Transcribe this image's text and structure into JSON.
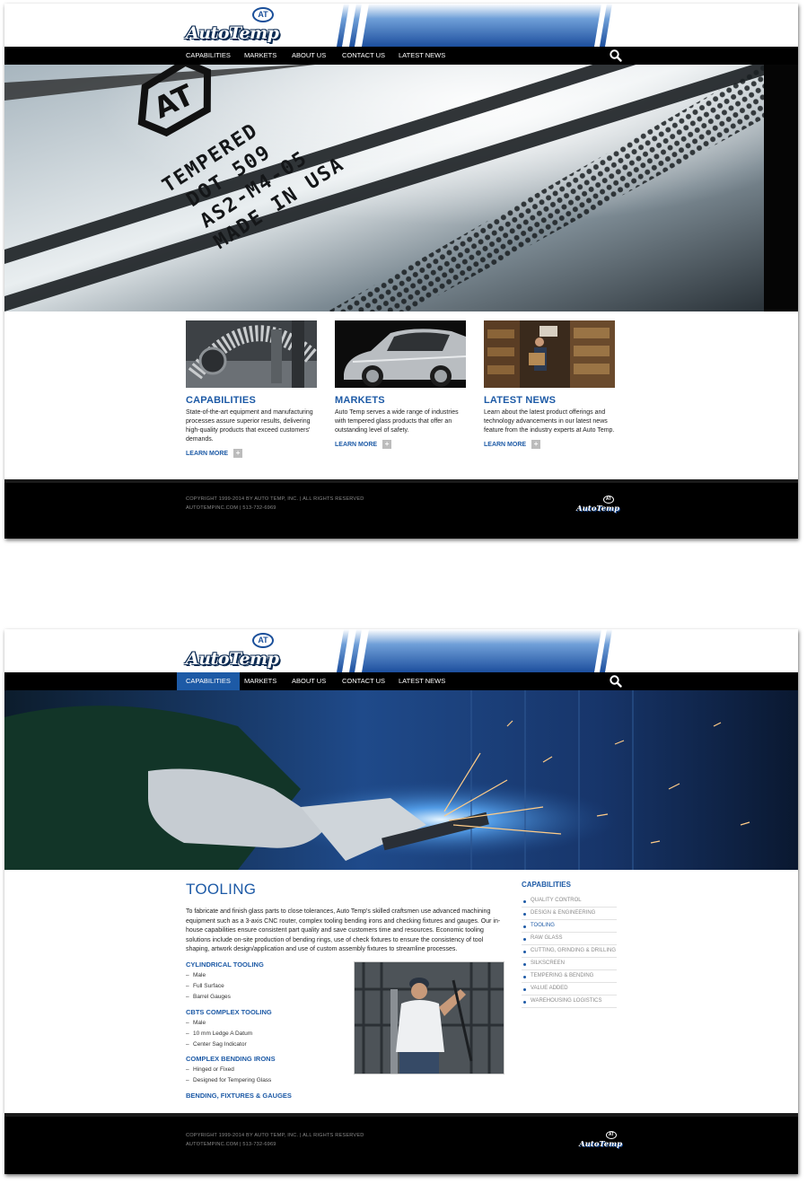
{
  "brand": {
    "name": "AutoTemp",
    "badge": "AT"
  },
  "nav": {
    "items": [
      "CAPABILITIES",
      "MARKETS",
      "ABOUT US",
      "CONTACT US",
      "LATEST NEWS"
    ]
  },
  "colors": {
    "brand_blue": "#1d5aa6",
    "nav_bg": "#000000",
    "footer_bg": "#000000"
  },
  "icons": {
    "search": "search-icon",
    "learn_more": "plus-icon"
  },
  "home": {
    "hero": {
      "etched_lines": [
        "TEMPERED",
        "DOT 509",
        "AS2-M4-05",
        "MADE IN USA"
      ],
      "logo_mark": "AT"
    },
    "cards": [
      {
        "title": "CAPABILITIES",
        "text": "State-of-the-art equipment and manufacturing processes assure superior results, delivering high-quality products that exceed customers' demands.",
        "link": "LEARN MORE"
      },
      {
        "title": "MARKETS",
        "text": "Auto Temp serves a wide range of industries with tempered glass products that offer an outstanding level of safety.",
        "link": "LEARN MORE"
      },
      {
        "title": "LATEST NEWS",
        "text": "Learn about the latest product offerings and technology advancements in our latest news feature from the industry experts at Auto Temp.",
        "link": "LEARN MORE"
      }
    ]
  },
  "footer": {
    "copyright": "COPYRIGHT 1999-2014 BY AUTO TEMP, INC.  |  ALL RIGHTS RESERVED",
    "contact": "AUTOTEMPINC.COM  |  513-732-6969"
  },
  "tooling": {
    "active_nav": "CAPABILITIES",
    "title": "TOOLING",
    "intro": "To fabricate and finish glass parts to close tolerances, Auto Temp's skilled craftsmen use advanced machining equipment such as a 3-axis CNC router, complex tooling bending irons and checking fixtures and gauges. Our in-house capabilities ensure consistent part quality and save customers time and resources. Economic tooling solutions include on-site production of bending rings, use of check fixtures to ensure the consistency of tool shaping, artwork design/application and use of custom assembly fixtures to streamline processes.",
    "sections": [
      {
        "heading": "CYLINDRICAL TOOLING",
        "items": [
          "Male",
          "Full Surface",
          "Barrel Gauges"
        ]
      },
      {
        "heading": "CBTS COMPLEX TOOLING",
        "items": [
          "Male",
          "10 mm Ledge A Datum",
          "Center Sag Indicator"
        ]
      },
      {
        "heading": "COMPLEX BENDING IRONS",
        "items": [
          "Hinged or Fixed",
          "Designed for Tempering Glass"
        ]
      },
      {
        "heading": "BENDING, FIXTURES & GAUGES",
        "items": []
      }
    ],
    "sidebar": {
      "title": "CAPABILITIES",
      "items": [
        "QUALITY CONTROL",
        "DESIGN & ENGINEERING",
        "TOOLING",
        "RAW GLASS",
        "CUTTING, GRINDING & DRILLING",
        "SILKSCREEN",
        "TEMPERING & BENDING",
        "VALUE ADDED",
        "WAREHOUSING LOGISTICS"
      ],
      "active": "TOOLING"
    }
  }
}
